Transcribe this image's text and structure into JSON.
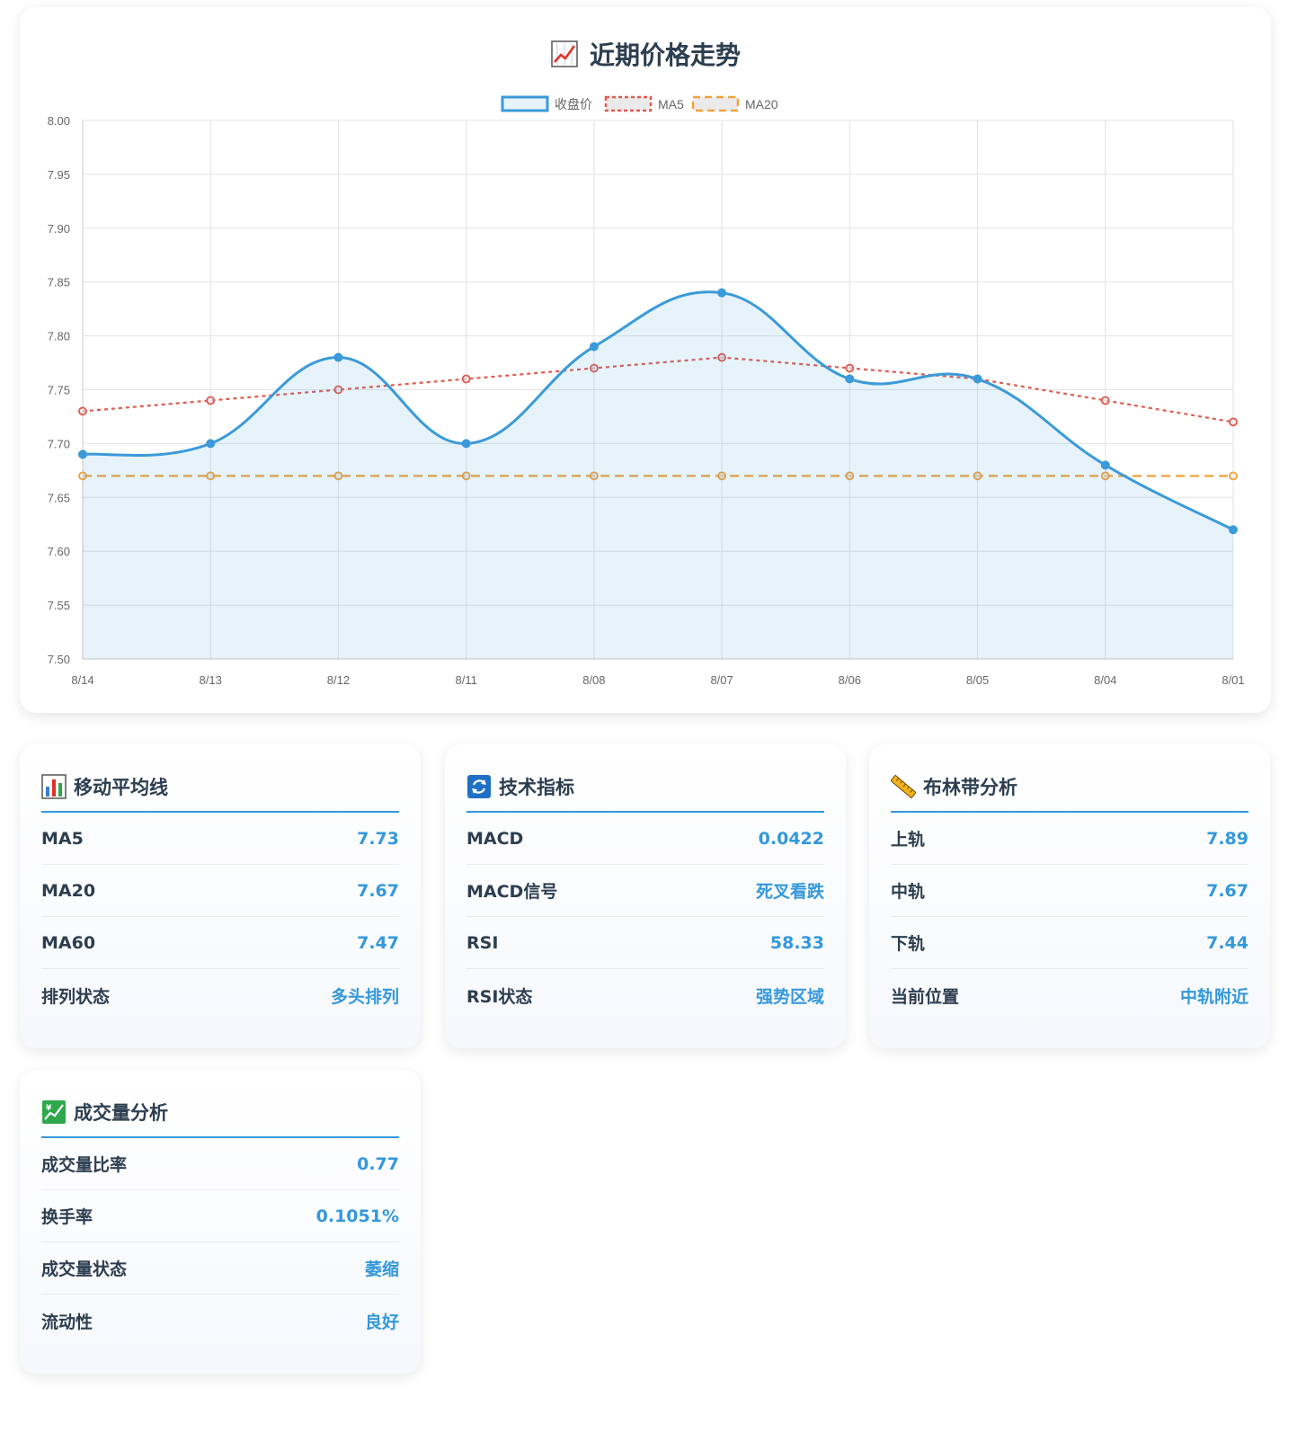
{
  "chart_section": {
    "title": "近期价格走势",
    "icon": "chart-increasing-icon"
  },
  "chart_data": {
    "type": "line",
    "categories": [
      "8/14",
      "8/13",
      "8/12",
      "8/11",
      "8/08",
      "8/07",
      "8/06",
      "8/05",
      "8/04",
      "8/01"
    ],
    "series": [
      {
        "name": "收盘价",
        "values": [
          7.69,
          7.7,
          7.78,
          7.7,
          7.79,
          7.84,
          7.76,
          7.76,
          7.68,
          7.62
        ],
        "color": "#3b9ad9",
        "style": "solid",
        "fill": true
      },
      {
        "name": "MA5",
        "values": [
          7.73,
          7.74,
          7.75,
          7.76,
          7.77,
          7.78,
          7.77,
          7.76,
          7.74,
          7.72
        ],
        "color": "#e05a4f",
        "style": "dotted",
        "fill": false
      },
      {
        "name": "MA20",
        "values": [
          7.67,
          7.67,
          7.67,
          7.67,
          7.67,
          7.67,
          7.67,
          7.67,
          7.67,
          7.67
        ],
        "color": "#f0a23c",
        "style": "dashed",
        "fill": false
      }
    ],
    "y_ticks": [
      "8.00",
      "7.95",
      "7.90",
      "7.85",
      "7.80",
      "7.75",
      "7.70",
      "7.65",
      "7.60",
      "7.55",
      "7.50"
    ],
    "ylim": [
      7.5,
      8.0
    ],
    "grid": true,
    "legend_position": "top-center"
  },
  "cards": [
    {
      "title": "移动平均线",
      "icon": "bar-chart-icon",
      "rows": [
        {
          "label": "MA5",
          "value": "7.73"
        },
        {
          "label": "MA20",
          "value": "7.67"
        },
        {
          "label": "MA60",
          "value": "7.47"
        },
        {
          "label": "排列状态",
          "value": "多头排列"
        }
      ]
    },
    {
      "title": "技术指标",
      "icon": "refresh-icon",
      "rows": [
        {
          "label": "MACD",
          "value": "0.0422"
        },
        {
          "label": "MACD信号",
          "value": "死叉看跌"
        },
        {
          "label": "RSI",
          "value": "58.33"
        },
        {
          "label": "RSI状态",
          "value": "强势区域"
        }
      ]
    },
    {
      "title": "布林带分析",
      "icon": "ruler-icon",
      "rows": [
        {
          "label": "上轨",
          "value": "7.89"
        },
        {
          "label": "中轨",
          "value": "7.67"
        },
        {
          "label": "下轨",
          "value": "7.44"
        },
        {
          "label": "当前位置",
          "value": "中轨附近"
        }
      ]
    },
    {
      "title": "成交量分析",
      "icon": "yen-chart-icon",
      "rows": [
        {
          "label": "成交量比率",
          "value": "0.77"
        },
        {
          "label": "换手率",
          "value": "0.1051%"
        },
        {
          "label": "成交量状态",
          "value": "萎缩"
        },
        {
          "label": "流动性",
          "value": "良好"
        }
      ]
    }
  ],
  "colors": {
    "accent": "#3498db",
    "heading": "#2c3e50"
  }
}
